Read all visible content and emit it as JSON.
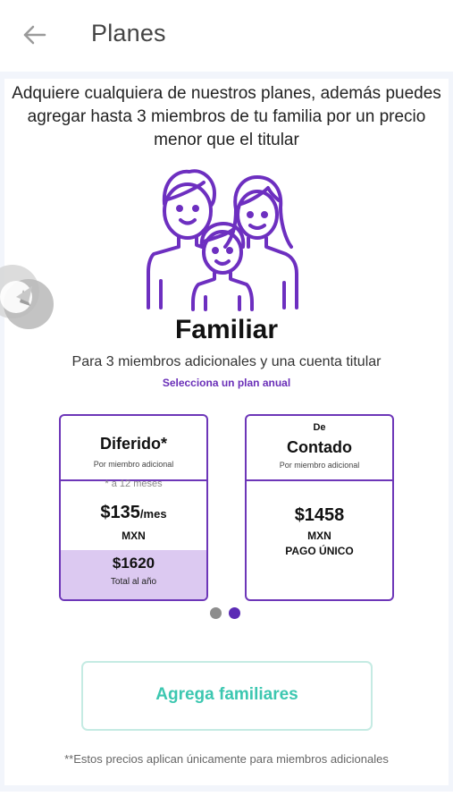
{
  "header": {
    "title": "Planes",
    "back_icon": "arrow-left-icon"
  },
  "intro": {
    "line1": "Adquiere cualquiera de nuestros planes, además puedes",
    "line2": "agregar hasta 3 miembros de tu familia por un precio",
    "line3": "menor que el titular"
  },
  "plan": {
    "illustration_icon": "family-icon",
    "name": "Familiar",
    "description": "Para 3 miembros adicionales y una cuenta titular",
    "hint": "Selecciona un plan anual"
  },
  "cards": {
    "deferred": {
      "title": "Diferido*",
      "per_member": "Por miembro adicional",
      "term": "* a 12 meses",
      "price": "$135",
      "per_month": "/mes",
      "currency": "MXN",
      "total_price": "$1620",
      "total_label": "Total al año"
    },
    "cash": {
      "prefix": "De",
      "title": "Contado",
      "per_member": "Por miembro adicional",
      "price": "$1458",
      "currency": "MXN",
      "payment_label": "PAGO ÚNICO"
    }
  },
  "carousel": {
    "page_count": 2,
    "active_index": 1
  },
  "cta": {
    "label": "Agrega familiares"
  },
  "footnote": "**Estos precios aplican únicamente para miembros adicionales",
  "colors": {
    "accent_purple": "#6d36b8",
    "accent_teal": "#3cc7b0",
    "card_highlight": "#dcc9f1"
  }
}
